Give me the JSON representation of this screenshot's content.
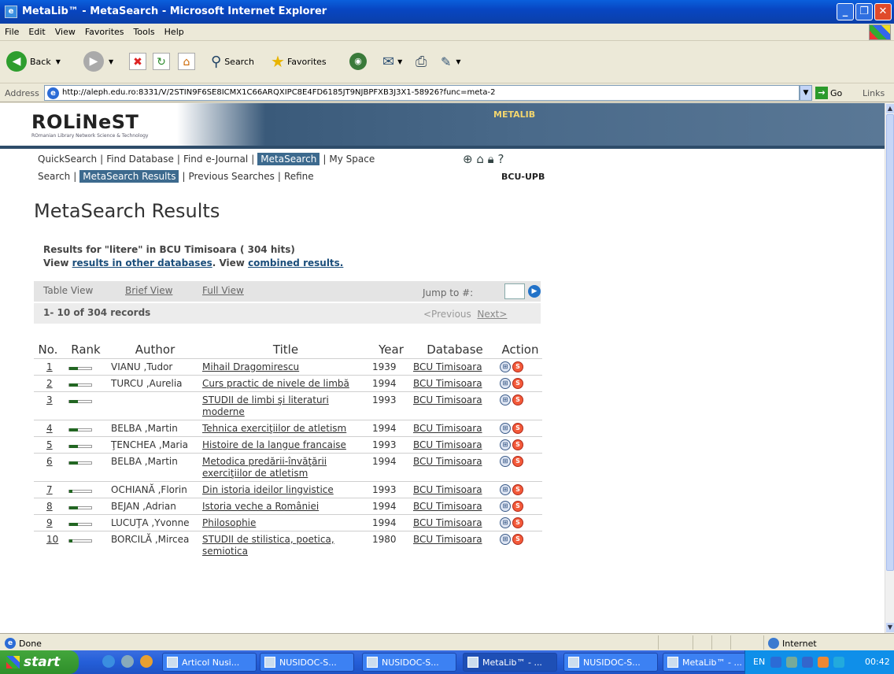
{
  "window": {
    "title": "MetaLib™ - MetaSearch - Microsoft Internet Explorer"
  },
  "menu": [
    "File",
    "Edit",
    "View",
    "Favorites",
    "Tools",
    "Help"
  ],
  "toolbar": {
    "back": "Back",
    "search": "Search",
    "favorites": "Favorites"
  },
  "address": {
    "label": "Address",
    "url": "http://aleph.edu.ro:8331/V/2STIN9F6SE8ICMX1C66ARQXIPC8E4FD6185JT9NJBPFXB3J3X1-58926?func=meta-2",
    "go": "Go",
    "links": "Links"
  },
  "header": {
    "logo": "ROLiNeST",
    "logo_sub": "ROmanian Library Network Science & Technology",
    "product": "METALIB",
    "institution": "BCU-UPB"
  },
  "nav1": [
    "QuickSearch",
    "Find Database",
    "Find e-Journal",
    "MetaSearch",
    "My Space"
  ],
  "nav2": [
    "Search",
    "MetaSearch Results",
    "Previous Searches",
    "Refine"
  ],
  "page_title": "MetaSearch Results",
  "results_for": "Results for \"litere\" in BCU Timisoara ( 304 hits)",
  "view_line": {
    "view1": "View ",
    "link1": "results in other databases",
    "view2": ". View ",
    "link2": "combined results."
  },
  "views": {
    "table": "Table View",
    "brief": "Brief View",
    "full": "Full View",
    "jump": "Jump to #:"
  },
  "records": {
    "count": "1- 10 of 304 records",
    "prev": "<Previous",
    "next": "Next>"
  },
  "columns": {
    "no": "No.",
    "rank": "Rank",
    "author": "Author",
    "title": "Title",
    "year": "Year",
    "database": "Database",
    "action": "Action"
  },
  "rows": [
    {
      "no": "1",
      "rank": 0.4,
      "author": "VIANU ,Tudor",
      "title": "Mihail Dragomirescu",
      "year": "1939",
      "db": "BCU Timisoara"
    },
    {
      "no": "2",
      "rank": 0.4,
      "author": "TURCU ,Aurelia",
      "title": "Curs practic de nivele de limbă",
      "year": "1994",
      "db": "BCU Timisoara"
    },
    {
      "no": "3",
      "rank": 0.4,
      "author": "",
      "title": "STUDII de limbi şi literaturi moderne",
      "year": "1993",
      "db": "BCU Timisoara"
    },
    {
      "no": "4",
      "rank": 0.4,
      "author": "BELBA ,Martin",
      "title": "Tehnica exerciţiilor de atletism",
      "year": "1994",
      "db": "BCU Timisoara"
    },
    {
      "no": "5",
      "rank": 0.4,
      "author": "ŢENCHEA ,Maria",
      "title": "Histoire de la langue francaise",
      "year": "1993",
      "db": "BCU Timisoara"
    },
    {
      "no": "6",
      "rank": 0.4,
      "author": "BELBA ,Martin",
      "title": "Metodica predării-învăţării exerciţiilor de atletism",
      "year": "1994",
      "db": "BCU Timisoara"
    },
    {
      "no": "7",
      "rank": 0.15,
      "author": "OCHIANĂ ,Florin",
      "title": "Din istoria ideilor lingvistice",
      "year": "1993",
      "db": "BCU Timisoara"
    },
    {
      "no": "8",
      "rank": 0.4,
      "author": "BEJAN ,Adrian",
      "title": "Istoria veche a României",
      "year": "1994",
      "db": "BCU Timisoara"
    },
    {
      "no": "9",
      "rank": 0.4,
      "author": "LUCUŢA ,Yvonne",
      "title": "Philosophie",
      "year": "1994",
      "db": "BCU Timisoara"
    },
    {
      "no": "10",
      "rank": 0.15,
      "author": "BORCILĂ ,Mircea",
      "title": "STUDII de stilistica, poetica, semiotica",
      "year": "1980",
      "db": "BCU Timisoara"
    }
  ],
  "status": {
    "text": "Done",
    "zone": "Internet"
  },
  "taskbar": {
    "start": "start",
    "tasks": [
      "Articol Nusi...",
      "NUSIDOC-S...",
      "NUSIDOC-S...",
      "MetaLib™ - ...",
      "NUSIDOC-S...",
      "MetaLib™ - ..."
    ],
    "lang": "EN",
    "clock": "00:42"
  }
}
